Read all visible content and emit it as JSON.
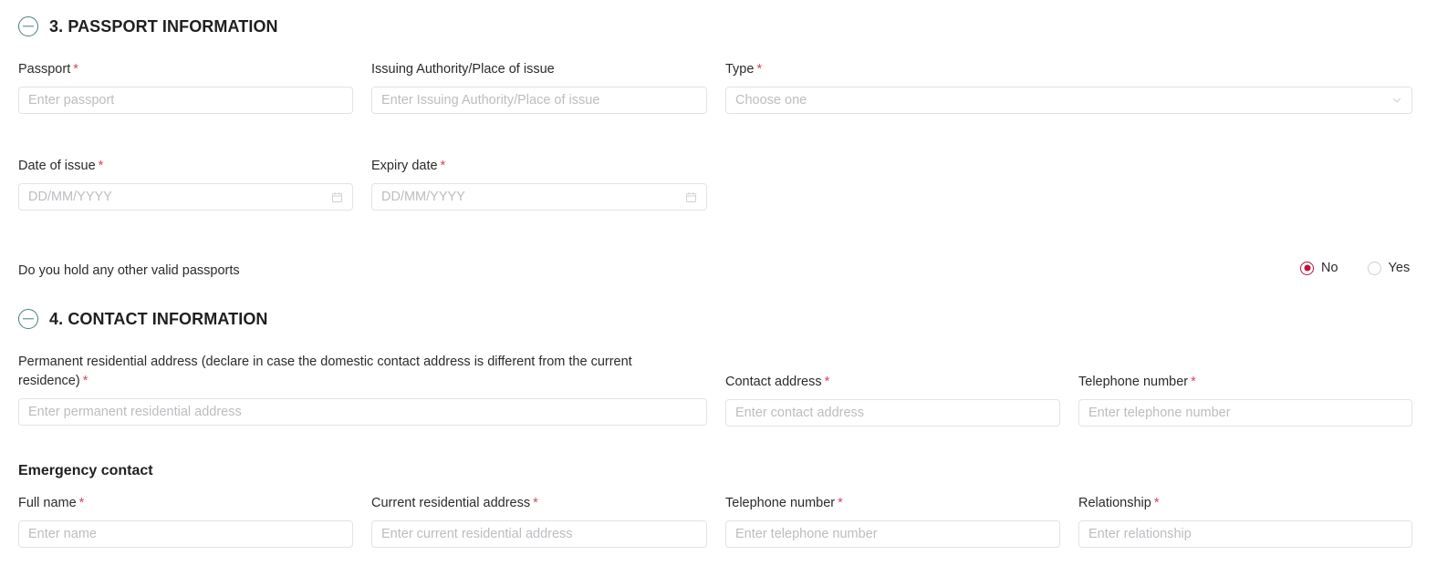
{
  "sections": [
    {
      "icon": "circle-minus-icon",
      "title": "3. PASSPORT INFORMATION",
      "fields": {
        "passport": {
          "label": "Passport",
          "required": true,
          "placeholder": "Enter passport",
          "value": ""
        },
        "issuing_authority": {
          "label": "Issuing Authority/Place of issue",
          "required": false,
          "placeholder": "Enter Issuing Authority/Place of issue",
          "value": ""
        },
        "type": {
          "label": "Type",
          "required": true,
          "placeholder": "Choose one",
          "value": "",
          "icon": "chevron-down-icon"
        },
        "date_of_issue": {
          "label": "Date of issue",
          "required": true,
          "placeholder": "DD/MM/YYYY",
          "value": "",
          "icon": "calendar-icon"
        },
        "expiry_date": {
          "label": "Expiry date",
          "required": true,
          "placeholder": "DD/MM/YYYY",
          "value": "",
          "icon": "calendar-icon"
        }
      },
      "question": {
        "label": "Do you hold any other valid passports",
        "options": [
          {
            "label": "No",
            "selected": true
          },
          {
            "label": "Yes",
            "selected": false
          }
        ]
      }
    },
    {
      "icon": "circle-minus-icon",
      "title": "4. CONTACT INFORMATION",
      "fields": {
        "permanent_address": {
          "label": "Permanent residential address (declare in case the domestic contact address is different from the current residence)",
          "required": true,
          "placeholder": "Enter permanent residential address",
          "value": ""
        },
        "contact_address": {
          "label": "Contact address",
          "required": true,
          "placeholder": "Enter contact address",
          "value": ""
        },
        "telephone_number": {
          "label": "Telephone number",
          "required": true,
          "placeholder": "Enter telephone number",
          "value": ""
        }
      },
      "subsection": {
        "heading": "Emergency contact",
        "fields": {
          "full_name": {
            "label": "Full name",
            "required": true,
            "placeholder": "Enter name",
            "value": ""
          },
          "current_address": {
            "label": "Current residential address",
            "required": true,
            "placeholder": "Enter current residential address",
            "value": ""
          },
          "emergency_telephone": {
            "label": "Telephone number",
            "required": true,
            "placeholder": "Enter telephone number",
            "value": ""
          },
          "relationship": {
            "label": "Relationship",
            "required": true,
            "placeholder": "Enter relationship",
            "value": ""
          }
        }
      }
    }
  ],
  "colors": {
    "required_asterisk": "#d6455d",
    "radio_selected": "#c2103a",
    "section_icon": "#4a7d7e",
    "input_border": "#e3e3e5",
    "placeholder_text": "#bdbdc2"
  }
}
